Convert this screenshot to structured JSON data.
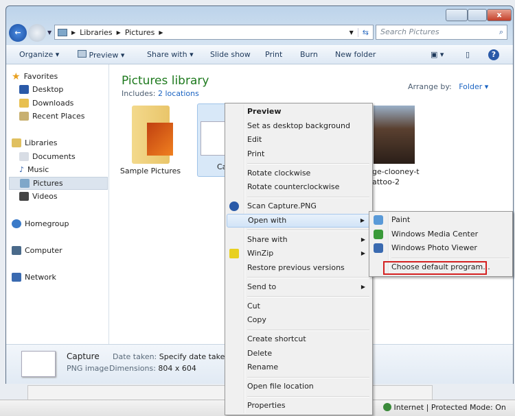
{
  "window": {
    "address": [
      "Libraries",
      "Pictures"
    ],
    "search_placeholder": "Search Pictures",
    "close": "x"
  },
  "commandbar": {
    "organize": "Organize",
    "preview": "Preview",
    "share_with": "Share with",
    "slide_show": "Slide show",
    "print": "Print",
    "burn": "Burn",
    "new_folder": "New folder"
  },
  "sidebar": {
    "favorites": "Favorites",
    "desktop": "Desktop",
    "downloads": "Downloads",
    "recent": "Recent Places",
    "libraries": "Libraries",
    "documents": "Documents",
    "music": "Music",
    "pictures": "Pictures",
    "videos": "Videos",
    "homegroup": "Homegroup",
    "computer": "Computer",
    "network": "Network"
  },
  "library": {
    "title": "Pictures library",
    "includes_label": "Includes:",
    "includes_link": "2 locations",
    "arrange_label": "Arrange by:",
    "arrange_value": "Folder"
  },
  "files": [
    {
      "name": "Sample Pictures"
    },
    {
      "name": "Ca"
    },
    {
      "name_line1": "ge-clooney-t",
      "name_line2": "attoo-2"
    }
  ],
  "details": {
    "name": "Capture",
    "type": "PNG image",
    "date_label": "Date taken:",
    "date_value": "Specify date taken",
    "dim_label": "Dimensions:",
    "dim_value": "804 x 604"
  },
  "context_menu": [
    "Preview",
    "Set as desktop background",
    "Edit",
    "Print",
    "Rotate clockwise",
    "Rotate counterclockwise",
    "Scan Capture.PNG",
    "Open with",
    "Share with",
    "WinZip",
    "Restore previous versions",
    "Send to",
    "Cut",
    "Copy",
    "Create shortcut",
    "Delete",
    "Rename",
    "Open file location",
    "Properties"
  ],
  "submenu": [
    "Paint",
    "Windows Media Center",
    "Windows Photo Viewer",
    "Choose default program..."
  ],
  "status": {
    "zone": "Internet | Protected Mode: On"
  },
  "colors": {
    "highlight": "#d2e4f7",
    "callout": "#d42020",
    "library_title": "#1e7a1e",
    "link": "#1a63c2"
  }
}
